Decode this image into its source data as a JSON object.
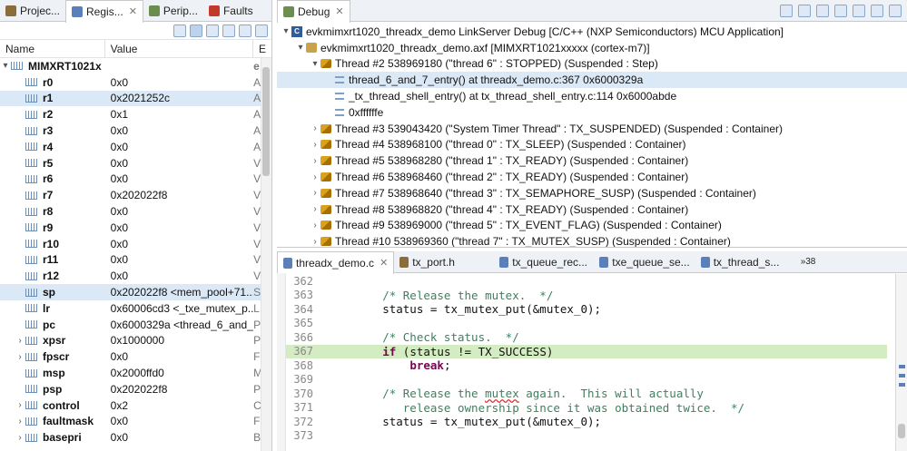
{
  "left_panel": {
    "tabs": [
      {
        "label": "Projec...",
        "icon": "project-icon"
      },
      {
        "label": "Regis...",
        "icon": "registers-icon",
        "active": true
      },
      {
        "label": "Perip...",
        "icon": "peripherals-icon"
      },
      {
        "label": "Faults",
        "icon": "faults-icon"
      }
    ],
    "columns": {
      "name": "Name",
      "value": "Value",
      "extra": "E"
    },
    "root": "MIMXRT1021x",
    "root_extra": "e",
    "registers": [
      {
        "name": "r0",
        "value": "0x0",
        "extra": "A"
      },
      {
        "name": "r1",
        "value": "0x2021252c",
        "extra": "A",
        "selected": true
      },
      {
        "name": "r2",
        "value": "0x1",
        "extra": "A"
      },
      {
        "name": "r3",
        "value": "0x0",
        "extra": "A"
      },
      {
        "name": "r4",
        "value": "0x0",
        "extra": "A"
      },
      {
        "name": "r5",
        "value": "0x0",
        "extra": "V"
      },
      {
        "name": "r6",
        "value": "0x0",
        "extra": "V"
      },
      {
        "name": "r7",
        "value": "0x202022f8",
        "extra": "V"
      },
      {
        "name": "r8",
        "value": "0x0",
        "extra": "V"
      },
      {
        "name": "r9",
        "value": "0x0",
        "extra": "V"
      },
      {
        "name": "r10",
        "value": "0x0",
        "extra": "V"
      },
      {
        "name": "r11",
        "value": "0x0",
        "extra": "V"
      },
      {
        "name": "r12",
        "value": "0x0",
        "extra": "V"
      },
      {
        "name": "sp",
        "value": "0x202022f8 <mem_pool+71...",
        "extra": "S",
        "selected": true
      },
      {
        "name": "lr",
        "value": "0x60006cd3 <_txe_mutex_p...",
        "extra": "L"
      },
      {
        "name": "pc",
        "value": "0x6000329a <thread_6_and_...",
        "extra": "P"
      },
      {
        "name": "xpsr",
        "value": "0x1000000",
        "extra": "P",
        "expandable": true
      },
      {
        "name": "fpscr",
        "value": "0x0",
        "extra": "F",
        "expandable": true
      },
      {
        "name": "msp",
        "value": "0x2000ffd0",
        "extra": "M"
      },
      {
        "name": "psp",
        "value": "0x202022f8",
        "extra": "P"
      },
      {
        "name": "control",
        "value": "0x2",
        "extra": "C",
        "expandable": true
      },
      {
        "name": "faultmask",
        "value": "0x0",
        "extra": "F",
        "expandable": true
      },
      {
        "name": "basepri",
        "value": "0x0",
        "extra": "B",
        "expandable": true
      }
    ]
  },
  "debug_panel": {
    "tab_label": "Debug",
    "launch": "evkmimxrt1020_threadx_demo LinkServer Debug [C/C++ (NXP Semiconductors) MCU Application]",
    "binary": "evkmimxrt1020_threadx_demo.axf [MIMXRT1021xxxxx (cortex-m7)]",
    "current_thread": "Thread #2 538969180 (\"thread 6\" : STOPPED) (Suspended : Step)",
    "frames": [
      {
        "label": "thread_6_and_7_entry() at threadx_demo.c:367 0x6000329a",
        "selected": true
      },
      {
        "label": "_tx_thread_shell_entry() at tx_thread_shell_entry.c:114 0x6000abde"
      },
      {
        "label": "0xffffffe"
      }
    ],
    "threads": [
      "Thread #3 539043420 (\"System Timer Thread\" : TX_SUSPENDED) (Suspended : Container)",
      "Thread #4 538968100 (\"thread 0\" : TX_SLEEP) (Suspended : Container)",
      "Thread #5 538968280 (\"thread 1\" : TX_READY) (Suspended : Container)",
      "Thread #6 538968460 (\"thread 2\" : TX_READY) (Suspended : Container)",
      "Thread #7 538968640 (\"thread 3\" : TX_SEMAPHORE_SUSP) (Suspended : Container)",
      "Thread #8 538968820 (\"thread 4\" : TX_READY) (Suspended : Container)",
      "Thread #9 538969000 (\"thread 5\" : TX_EVENT_FLAG) (Suspended : Container)",
      "Thread #10 538969360 (\"thread 7\" : TX_MUTEX_SUSP) (Suspended : Container)"
    ]
  },
  "editor": {
    "tabs": [
      {
        "label": "threadx_demo.c",
        "active": true,
        "closable": true
      },
      {
        "label": "tx_port.h"
      },
      {
        "label": "tx_queue_rec..."
      },
      {
        "label": "txe_queue_se..."
      },
      {
        "label": "tx_thread_s..."
      }
    ],
    "overflow_label": "»38",
    "lines": [
      {
        "num": "362",
        "text": ""
      },
      {
        "num": "363",
        "text": "        /* Release the mutex.  */",
        "type": "comment"
      },
      {
        "num": "364",
        "text": "        status = tx_mutex_put(&mutex_0);",
        "type": "code"
      },
      {
        "num": "365",
        "text": ""
      },
      {
        "num": "366",
        "text": "        /* Check status.  */",
        "type": "comment"
      },
      {
        "num": "367",
        "text": "        if (status != TX_SUCCESS)",
        "type": "if",
        "highlight": true
      },
      {
        "num": "368",
        "text": "            break;",
        "type": "break"
      },
      {
        "num": "369",
        "text": ""
      },
      {
        "num": "370",
        "text": "        /* Release the mutex again.  This will actually",
        "type": "comment2"
      },
      {
        "num": "371",
        "text": "           release ownership since it was obtained twice.  */",
        "type": "comment"
      },
      {
        "num": "372",
        "text": "        status = tx_mutex_put(&mutex_0);",
        "type": "code"
      },
      {
        "num": "373",
        "text": ""
      }
    ]
  },
  "colors": {
    "accent": "#2f5d9b",
    "selection": "#dbe8f6",
    "current_line": "#d4ecc2",
    "comment": "#3f7f5f",
    "keyword": "#7f0055"
  }
}
